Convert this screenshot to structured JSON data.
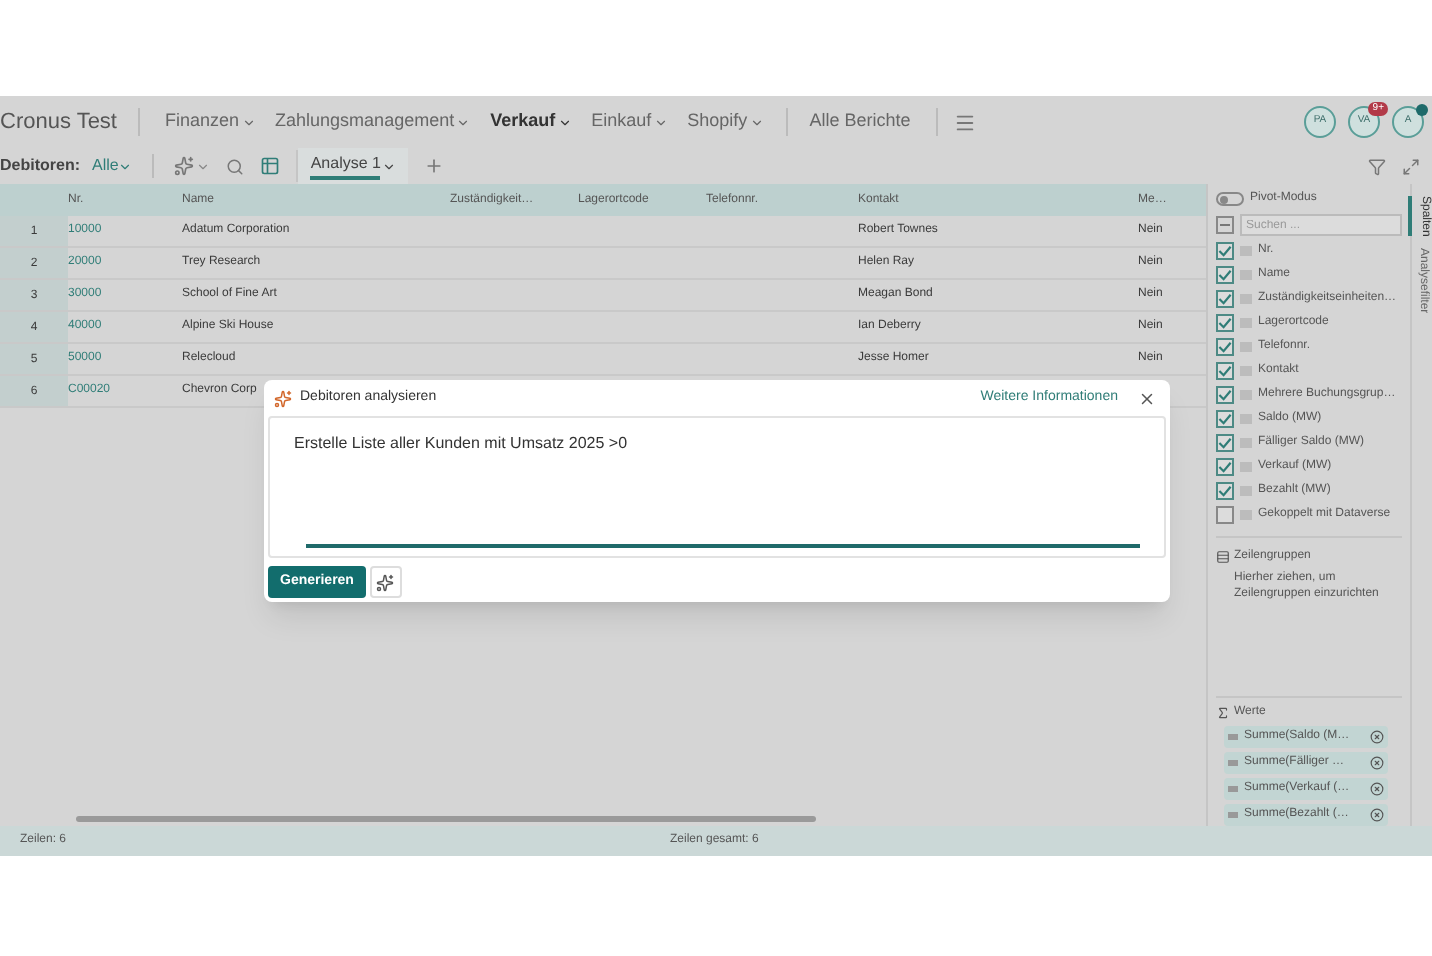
{
  "app_title": "Cronus Test",
  "nav": [
    {
      "label": "Finanzen",
      "selected": false,
      "dropdown": true
    },
    {
      "label": "Zahlungsmanagement",
      "selected": false,
      "dropdown": true
    },
    {
      "label": "Verkauf",
      "selected": true,
      "dropdown": true
    },
    {
      "label": "Einkauf",
      "selected": false,
      "dropdown": true
    },
    {
      "label": "Shopify",
      "selected": false,
      "dropdown": true
    },
    {
      "label": "Alle Berichte",
      "selected": false,
      "dropdown": false
    }
  ],
  "avatars": [
    {
      "initials": "PA"
    },
    {
      "initials": "VA",
      "badge": "9+"
    },
    {
      "initials": "A",
      "kind": "dot"
    }
  ],
  "view_bar": {
    "label": "Debitoren:",
    "filter": "Alle",
    "tabs": [
      {
        "label": "Analyse 1",
        "selected": true
      }
    ]
  },
  "table": {
    "columns": [
      "Nr.",
      "Name",
      "Zuständigkeit…",
      "Lagerortcode",
      "Telefonnr.",
      "Kontakt",
      "Me…"
    ],
    "rows": [
      {
        "index": "1",
        "nr": "10000",
        "name": "Adatum Corporation",
        "contact": "Robert Townes",
        "flag": "Nein"
      },
      {
        "index": "2",
        "nr": "20000",
        "name": "Trey Research",
        "contact": "Helen Ray",
        "flag": "Nein"
      },
      {
        "index": "3",
        "nr": "30000",
        "name": "School of Fine Art",
        "contact": "Meagan Bond",
        "flag": "Nein"
      },
      {
        "index": "4",
        "nr": "40000",
        "name": "Alpine Ski House",
        "contact": "Ian Deberry",
        "flag": "Nein"
      },
      {
        "index": "5",
        "nr": "50000",
        "name": "Relecloud",
        "contact": "Jesse Homer",
        "flag": "Nein"
      },
      {
        "index": "6",
        "nr": "C00020",
        "name": "Chevron Corp"
      }
    ]
  },
  "status_bar": {
    "rows": "Zeilen: 6",
    "total": "Zeilen gesamt: 6"
  },
  "panel": {
    "pivot": {
      "label": "Pivot-Modus",
      "on": false
    },
    "search": {
      "placeholder": "Suchen ..."
    },
    "columns": [
      {
        "label": "Nr.",
        "checked": true
      },
      {
        "label": "Name",
        "checked": true
      },
      {
        "label": "Zuständigkeitseinheiten…",
        "checked": true
      },
      {
        "label": "Lagerortcode",
        "checked": true
      },
      {
        "label": "Telefonnr.",
        "checked": true
      },
      {
        "label": "Kontakt",
        "checked": true
      },
      {
        "label": "Mehrere Buchungsgrup…",
        "checked": true
      },
      {
        "label": "Saldo (MW)",
        "checked": true
      },
      {
        "label": "Fälliger Saldo (MW)",
        "checked": true
      },
      {
        "label": "Verkauf (MW)",
        "checked": true
      },
      {
        "label": "Bezahlt (MW)",
        "checked": true
      },
      {
        "label": "Gekoppelt mit Dataverse",
        "checked": false
      }
    ],
    "row_groups": {
      "title": "Zeilengruppen",
      "hint": "Hierher ziehen, um Zeilengruppen einzurichten"
    },
    "values": {
      "title": "Werte",
      "items": [
        "Summe(Saldo (M…",
        "Summe(Fälliger …",
        "Summe(Verkauf (…",
        "Summe(Bezahlt (…"
      ]
    }
  },
  "side_tabs": [
    {
      "label": "Spalten",
      "selected": true
    },
    {
      "label": "Analysefilter",
      "selected": false
    }
  ],
  "dialog": {
    "title": "Debitoren analysieren",
    "link": "Weitere Informationen",
    "prompt": "Erstelle Liste aller Kunden mit Umsatz 2025 >0",
    "button": "Generieren"
  }
}
